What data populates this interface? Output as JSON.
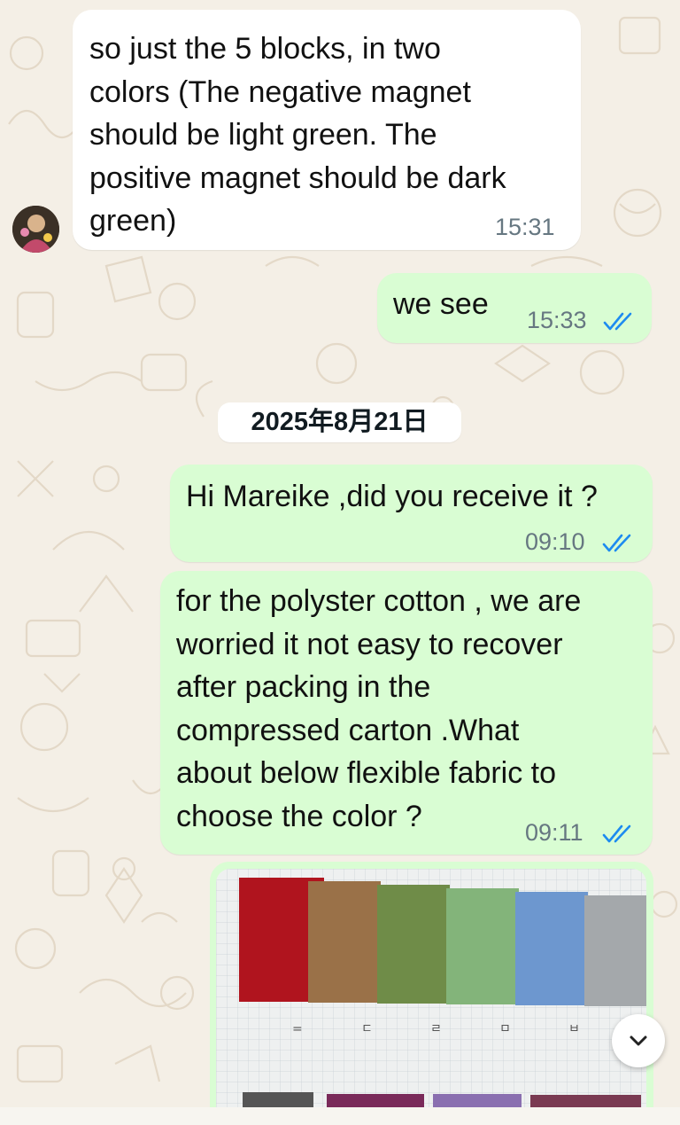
{
  "chat": {
    "messages": [
      {
        "direction": "incoming",
        "text": "so just the 5 blocks, in two\ncolors (The negative magnet\nshould be light green. The\npositive magnet should be dark\ngreen)",
        "time": "15:31"
      },
      {
        "direction": "outgoing",
        "text": "we see",
        "time": "15:33",
        "status": "read"
      },
      {
        "direction": "outgoing",
        "text": "Hi Mareike ,did you receive it ?",
        "time": "09:10",
        "status": "read"
      },
      {
        "direction": "outgoing",
        "text": "for the polyster cotton , we are\nworried it not easy to recover\nafter packing in the\ncompressed carton .What\nabout below flexible fabric to\nchoose the color ?",
        "time": "09:11",
        "status": "read"
      }
    ],
    "date_separator": "2025年8月21日",
    "image_message": {
      "swatch_colors": [
        "#b0141e",
        "#9a7148",
        "#6f8c48",
        "#83b47a",
        "#6d97cf",
        "#a4a8ab"
      ],
      "swatch_labels": [
        "=",
        "ㄷ",
        "ㄹ",
        "ㅁ",
        "ㅂ",
        "ㅅ"
      ]
    }
  },
  "colors": {
    "incoming_bubble": "#ffffff",
    "outgoing_bubble": "#d9fdd3",
    "read_tick": "#1d8bf0",
    "background": "#f4efe6"
  },
  "icons": {
    "read_receipt": "double-check-icon",
    "scroll": "chevron-down-icon"
  }
}
